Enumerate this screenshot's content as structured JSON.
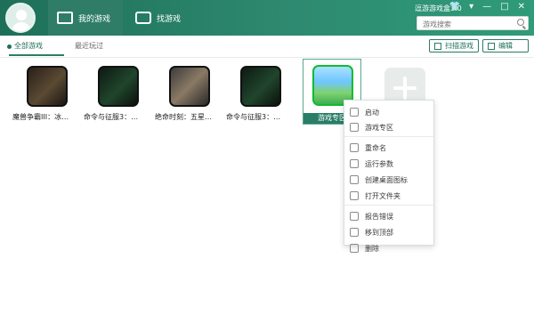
{
  "app": {
    "title": "逗游游戏盒3.0",
    "window_controls": [
      "shirt-icon",
      "dropdown-icon",
      "minimize-icon",
      "maximize-icon",
      "close-icon"
    ]
  },
  "nav": {
    "tabs": [
      {
        "label": "我的游戏",
        "icon": "gamepad-icon"
      },
      {
        "label": "找游戏",
        "icon": "controller-icon"
      }
    ]
  },
  "search": {
    "placeholder": "游戏搜索"
  },
  "subnav": {
    "tabs": [
      "全部游戏",
      "最近玩过"
    ],
    "actions": {
      "scan": "扫描游戏",
      "edit": "编辑"
    }
  },
  "games": [
    {
      "title": "魔兽争霸III：冰…"
    },
    {
      "title": "命令与征服3：…"
    },
    {
      "title": "绝命时刻：五星…"
    },
    {
      "title": "命令与征服3：…"
    }
  ],
  "selected_game": {
    "label": "游戏专区"
  },
  "context_menu": {
    "items": [
      "启动",
      "游戏专区",
      "重命名",
      "运行参数",
      "创建桌面图标",
      "打开文件夹",
      "报告错误",
      "移到顶部",
      "删除"
    ]
  },
  "colors": {
    "accent": "#2a7d66",
    "topbar": "#1d6f58"
  }
}
